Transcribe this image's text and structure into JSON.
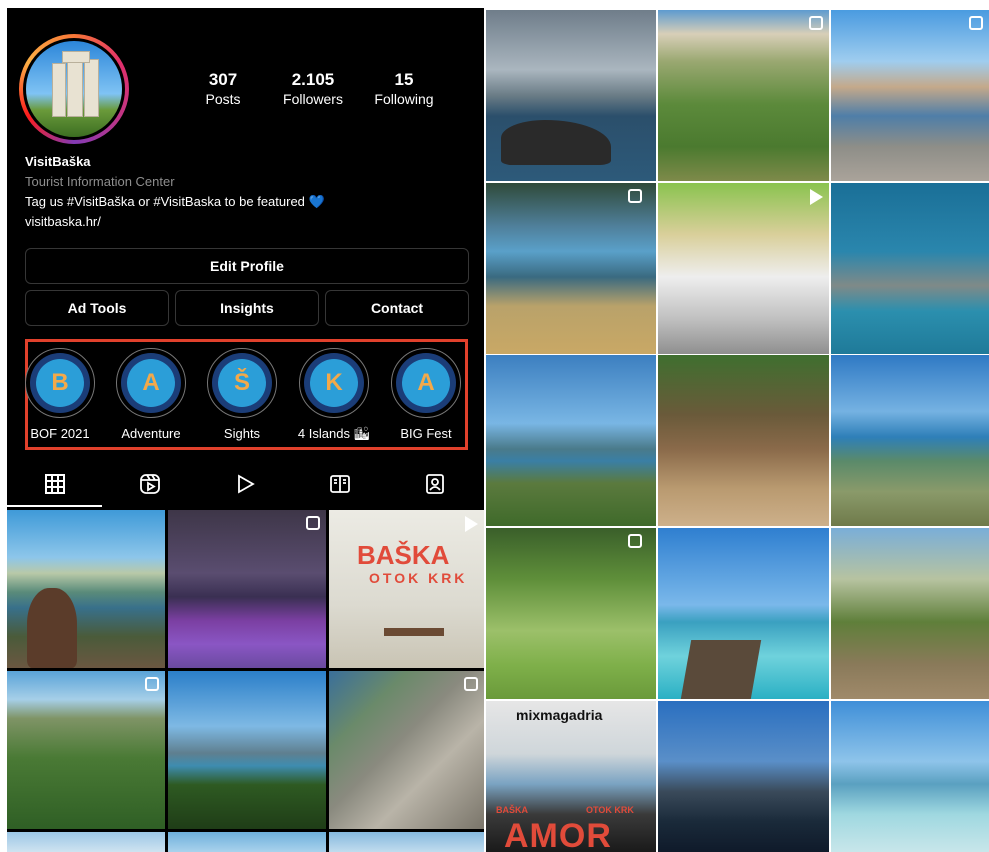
{
  "profile": {
    "stats": [
      {
        "num": "307",
        "label": "Posts"
      },
      {
        "num": "2.105",
        "label": "Followers"
      },
      {
        "num": "15",
        "label": "Following"
      }
    ],
    "name": "VisitBaška",
    "category": "Tourist Information Center",
    "bio": "Tag us #VisitBaška or #VisitBaska to be featured 💙",
    "link": "visitbaska.hr/"
  },
  "buttons": {
    "edit_profile": "Edit Profile",
    "ad_tools": "Ad Tools",
    "insights": "Insights",
    "contact": "Contact"
  },
  "highlights": [
    {
      "letter": "B",
      "label": "BOF 2021"
    },
    {
      "letter": "A",
      "label": "Adventure"
    },
    {
      "letter": "Š",
      "label": "Sights"
    },
    {
      "letter": "K",
      "label": "4 Islands 🏙"
    },
    {
      "letter": "A",
      "label": "BIG Fest"
    }
  ],
  "tabs": [
    "grid-icon",
    "reels-icon",
    "video-icon",
    "guides-icon",
    "tagged-icon"
  ],
  "left_posts": [
    {
      "overlay": "",
      "text1": "",
      "text2": ""
    },
    {
      "overlay": "multi",
      "text1": "",
      "text2": ""
    },
    {
      "overlay": "reel",
      "text1": "BAŠKA",
      "text2": "OTOK KRK"
    },
    {
      "overlay": "multi",
      "text1": "",
      "text2": ""
    },
    {
      "overlay": "",
      "text1": "",
      "text2": ""
    },
    {
      "overlay": "multi",
      "text1": "",
      "text2": ""
    }
  ],
  "right_posts": {
    "mix_title": "mixmagadria",
    "amor_title": "AMOR",
    "baska_small": "BAŠKA",
    "otok_small": "OTOK KRK"
  },
  "colors": {
    "background": "#000000",
    "highlight_frame": "#e1412c",
    "highlight_inner": "#2b9ed8",
    "highlight_letter": "#f3a94a"
  }
}
